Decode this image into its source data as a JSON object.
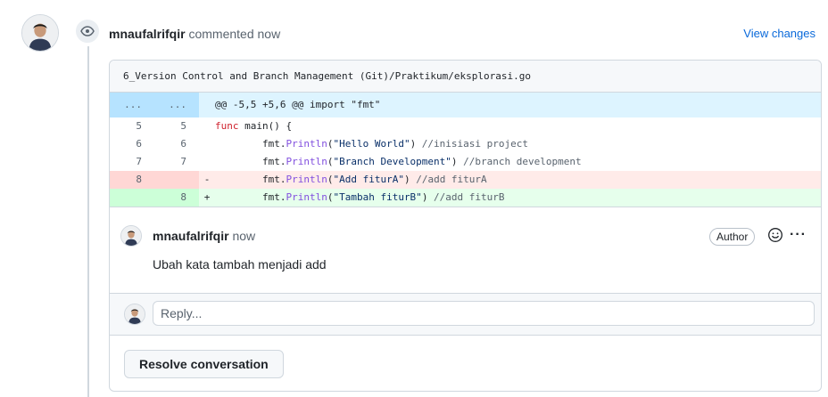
{
  "header": {
    "author": "mnaufalrifqir",
    "meta": "commented now",
    "view_changes": "View changes"
  },
  "file": {
    "path": "6_Version Control and Branch Management (Git)/Praktikum/eksplorasi.go"
  },
  "diff": {
    "hunk": {
      "left": "...",
      "right": "...",
      "text": "@@ -5,5 +5,6 @@ import \"fmt\""
    },
    "lines": [
      {
        "type": "context",
        "left": "5",
        "right": "5",
        "sign": "",
        "indent": "",
        "keyword": "func",
        "rest": " main() {"
      },
      {
        "type": "context",
        "left": "6",
        "right": "6",
        "sign": "",
        "indent": "        ",
        "pkg": "fmt.",
        "fn": "Println",
        "args_open": "(",
        "str": "\"Hello World\"",
        "args_close": ")",
        "comment": " //inisiasi project"
      },
      {
        "type": "context",
        "left": "7",
        "right": "7",
        "sign": "",
        "indent": "        ",
        "pkg": "fmt.",
        "fn": "Println",
        "args_open": "(",
        "str": "\"Branch Development\"",
        "args_close": ")",
        "comment": " //branch development"
      },
      {
        "type": "del",
        "left": "8",
        "right": "",
        "sign": "-",
        "indent": "        ",
        "pkg": "fmt.",
        "fn": "Println",
        "args_open": "(",
        "str": "\"Add fiturA\"",
        "args_close": ")",
        "comment": " //add fiturA"
      },
      {
        "type": "add",
        "left": "",
        "right": "8",
        "sign": "+",
        "indent": "        ",
        "pkg": "fmt.",
        "fn": "Println",
        "args_open": "(",
        "str": "\"Tambah fiturB\"",
        "args_close": ")",
        "comment": " //add fiturB"
      }
    ]
  },
  "comment": {
    "author": "mnaufalrifqir",
    "meta": "now",
    "badge": "Author",
    "body": "Ubah kata tambah menjadi add"
  },
  "reply": {
    "placeholder": "Reply..."
  },
  "resolve": {
    "label": "Resolve conversation"
  },
  "colors": {
    "link": "#0969da",
    "hunk_bg": "#ddf4ff",
    "del_bg": "#ffebe9",
    "add_bg": "#e6ffec"
  }
}
